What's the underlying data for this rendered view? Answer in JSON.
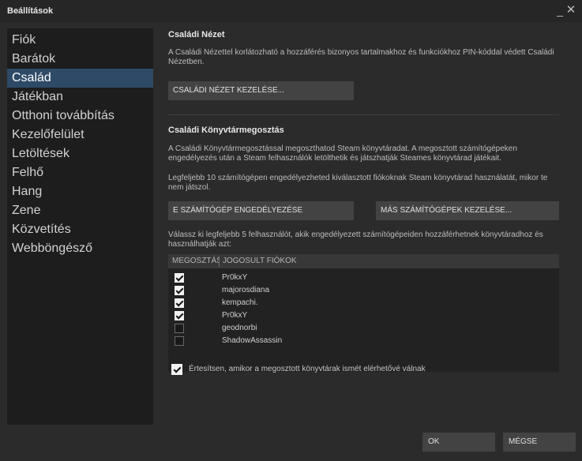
{
  "window": {
    "title": "Beállítások"
  },
  "sidebar": {
    "items": [
      {
        "label": "Fiók"
      },
      {
        "label": "Barátok"
      },
      {
        "label": "Család",
        "active": true
      },
      {
        "label": "Játékban"
      },
      {
        "label": "Otthoni továbbítás"
      },
      {
        "label": "Kezelőfelület"
      },
      {
        "label": "Letöltések"
      },
      {
        "label": "Felhő"
      },
      {
        "label": "Hang"
      },
      {
        "label": "Zene"
      },
      {
        "label": "Közvetítés"
      },
      {
        "label": "Webböngésző"
      }
    ]
  },
  "family_view": {
    "heading": "Családi Nézet",
    "description": "A Családi Nézettel korlátozható a hozzáférés bizonyos tartalmakhoz és funkciókhoz PIN-kóddal védett Családi Nézetben.",
    "manage_button": "CSALÁDI NÉZET KEZELÉSE..."
  },
  "library_sharing": {
    "heading": "Családi Könyvtármegosztás",
    "description": "A Családi Könyvtármegosztással megoszthatod Steam könyvtáradat. A megosztott számítógépeken engedélyezés után a Steam felhasználók letölthetik és játszhatják Steames könyvtárad játékait.",
    "limit_text": "Legfeljebb 10 számítógépen engedélyezheted kiválasztott fiókoknak Steam könyvtárad használatát, mikor te nem játszol.",
    "authorize_button": "E SZÁMÍTÓGÉP ENGEDÉLYEZÉSE",
    "manage_button": "MÁS SZÁMÍTÓGÉPEK KEZELÉSE...",
    "select_text": "Válassz ki legfeljebb 5 felhasználót, akik engedélyezett számítógépeiden hozzáférhetnek könyvtáradhoz és használhatják azt:",
    "table": {
      "col_share": "MEGOSZTÁS",
      "col_accounts": "JOGOSULT FIÓKOK",
      "rows": [
        {
          "name": "Pr0kxY",
          "checked": true
        },
        {
          "name": "majorosdiana",
          "checked": true
        },
        {
          "name": "kempachi.",
          "checked": true
        },
        {
          "name": "Pr0kxY",
          "checked": true
        },
        {
          "name": "geodnorbi",
          "checked": false
        },
        {
          "name": "ShadowAssassin",
          "checked": false
        }
      ]
    },
    "notify_label": "Értesítsen, amikor a megosztott könyvtárak ismét elérhetővé válnak",
    "notify_checked": true
  },
  "footer": {
    "ok_label": "OK",
    "cancel_label": "MÉGSE"
  },
  "icons": {
    "minimize": "minimize-icon",
    "close": "close-icon"
  },
  "colors": {
    "accent": "#2e4a67",
    "background": "#2b2b2b",
    "sidebar": "#1d1d1d",
    "button": "#434343"
  }
}
